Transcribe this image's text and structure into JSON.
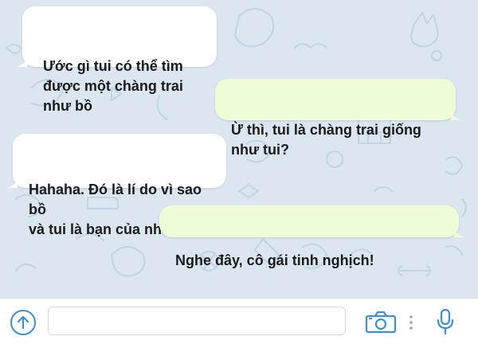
{
  "messages": [
    {
      "direction": "incoming",
      "text": "Ước gì tui có thể tìm\nđược một chàng trai\nnhư bồ"
    },
    {
      "direction": "outgoing",
      "text": "Ừ thì, tui là chàng trai giống\nnhư tui?"
    },
    {
      "direction": "incoming",
      "text": "Hahaha. Đó là lí do vì sao bồ\nvà tui là bạn của nhau đó."
    },
    {
      "direction": "outgoing",
      "text": "Nghe đây, cô gái tinh nghịch!"
    }
  ],
  "input": {
    "value": "",
    "placeholder": ""
  },
  "icons": {
    "attach": "upload-icon",
    "camera": "camera-icon",
    "more": "more-vertical-icon",
    "mic": "microphone-icon"
  },
  "colors": {
    "wallpaper": "#dbe6f0",
    "incoming_bubble": "#ffffff",
    "outgoing_bubble": "#eefdd8",
    "accent": "#3d8fd6"
  }
}
